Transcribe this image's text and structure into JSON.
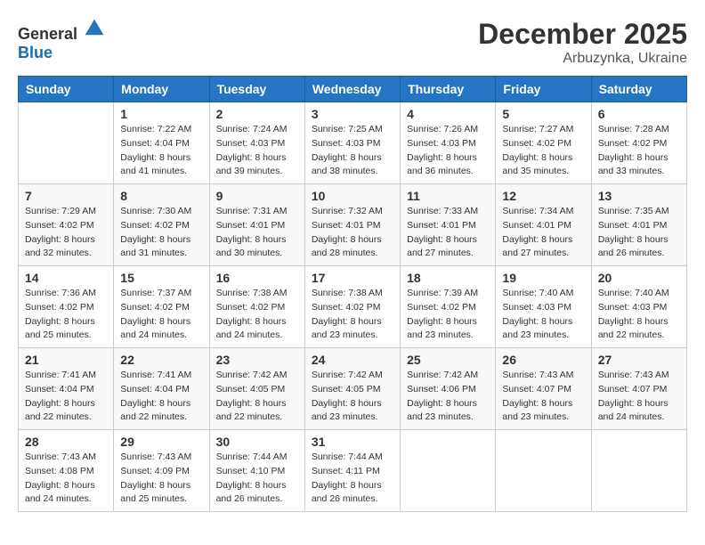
{
  "logo": {
    "general": "General",
    "blue": "Blue"
  },
  "title": "December 2025",
  "location": "Arbuzynka, Ukraine",
  "weekdays": [
    "Sunday",
    "Monday",
    "Tuesday",
    "Wednesday",
    "Thursday",
    "Friday",
    "Saturday"
  ],
  "weeks": [
    [
      {
        "day": "",
        "info": ""
      },
      {
        "day": "1",
        "info": "Sunrise: 7:22 AM\nSunset: 4:04 PM\nDaylight: 8 hours\nand 41 minutes."
      },
      {
        "day": "2",
        "info": "Sunrise: 7:24 AM\nSunset: 4:03 PM\nDaylight: 8 hours\nand 39 minutes."
      },
      {
        "day": "3",
        "info": "Sunrise: 7:25 AM\nSunset: 4:03 PM\nDaylight: 8 hours\nand 38 minutes."
      },
      {
        "day": "4",
        "info": "Sunrise: 7:26 AM\nSunset: 4:03 PM\nDaylight: 8 hours\nand 36 minutes."
      },
      {
        "day": "5",
        "info": "Sunrise: 7:27 AM\nSunset: 4:02 PM\nDaylight: 8 hours\nand 35 minutes."
      },
      {
        "day": "6",
        "info": "Sunrise: 7:28 AM\nSunset: 4:02 PM\nDaylight: 8 hours\nand 33 minutes."
      }
    ],
    [
      {
        "day": "7",
        "info": "Sunrise: 7:29 AM\nSunset: 4:02 PM\nDaylight: 8 hours\nand 32 minutes."
      },
      {
        "day": "8",
        "info": "Sunrise: 7:30 AM\nSunset: 4:02 PM\nDaylight: 8 hours\nand 31 minutes."
      },
      {
        "day": "9",
        "info": "Sunrise: 7:31 AM\nSunset: 4:01 PM\nDaylight: 8 hours\nand 30 minutes."
      },
      {
        "day": "10",
        "info": "Sunrise: 7:32 AM\nSunset: 4:01 PM\nDaylight: 8 hours\nand 28 minutes."
      },
      {
        "day": "11",
        "info": "Sunrise: 7:33 AM\nSunset: 4:01 PM\nDaylight: 8 hours\nand 27 minutes."
      },
      {
        "day": "12",
        "info": "Sunrise: 7:34 AM\nSunset: 4:01 PM\nDaylight: 8 hours\nand 27 minutes."
      },
      {
        "day": "13",
        "info": "Sunrise: 7:35 AM\nSunset: 4:01 PM\nDaylight: 8 hours\nand 26 minutes."
      }
    ],
    [
      {
        "day": "14",
        "info": "Sunrise: 7:36 AM\nSunset: 4:02 PM\nDaylight: 8 hours\nand 25 minutes."
      },
      {
        "day": "15",
        "info": "Sunrise: 7:37 AM\nSunset: 4:02 PM\nDaylight: 8 hours\nand 24 minutes."
      },
      {
        "day": "16",
        "info": "Sunrise: 7:38 AM\nSunset: 4:02 PM\nDaylight: 8 hours\nand 24 minutes."
      },
      {
        "day": "17",
        "info": "Sunrise: 7:38 AM\nSunset: 4:02 PM\nDaylight: 8 hours\nand 23 minutes."
      },
      {
        "day": "18",
        "info": "Sunrise: 7:39 AM\nSunset: 4:02 PM\nDaylight: 8 hours\nand 23 minutes."
      },
      {
        "day": "19",
        "info": "Sunrise: 7:40 AM\nSunset: 4:03 PM\nDaylight: 8 hours\nand 23 minutes."
      },
      {
        "day": "20",
        "info": "Sunrise: 7:40 AM\nSunset: 4:03 PM\nDaylight: 8 hours\nand 22 minutes."
      }
    ],
    [
      {
        "day": "21",
        "info": "Sunrise: 7:41 AM\nSunset: 4:04 PM\nDaylight: 8 hours\nand 22 minutes."
      },
      {
        "day": "22",
        "info": "Sunrise: 7:41 AM\nSunset: 4:04 PM\nDaylight: 8 hours\nand 22 minutes."
      },
      {
        "day": "23",
        "info": "Sunrise: 7:42 AM\nSunset: 4:05 PM\nDaylight: 8 hours\nand 22 minutes."
      },
      {
        "day": "24",
        "info": "Sunrise: 7:42 AM\nSunset: 4:05 PM\nDaylight: 8 hours\nand 23 minutes."
      },
      {
        "day": "25",
        "info": "Sunrise: 7:42 AM\nSunset: 4:06 PM\nDaylight: 8 hours\nand 23 minutes."
      },
      {
        "day": "26",
        "info": "Sunrise: 7:43 AM\nSunset: 4:07 PM\nDaylight: 8 hours\nand 23 minutes."
      },
      {
        "day": "27",
        "info": "Sunrise: 7:43 AM\nSunset: 4:07 PM\nDaylight: 8 hours\nand 24 minutes."
      }
    ],
    [
      {
        "day": "28",
        "info": "Sunrise: 7:43 AM\nSunset: 4:08 PM\nDaylight: 8 hours\nand 24 minutes."
      },
      {
        "day": "29",
        "info": "Sunrise: 7:43 AM\nSunset: 4:09 PM\nDaylight: 8 hours\nand 25 minutes."
      },
      {
        "day": "30",
        "info": "Sunrise: 7:44 AM\nSunset: 4:10 PM\nDaylight: 8 hours\nand 26 minutes."
      },
      {
        "day": "31",
        "info": "Sunrise: 7:44 AM\nSunset: 4:11 PM\nDaylight: 8 hours\nand 26 minutes."
      },
      {
        "day": "",
        "info": ""
      },
      {
        "day": "",
        "info": ""
      },
      {
        "day": "",
        "info": ""
      }
    ]
  ]
}
